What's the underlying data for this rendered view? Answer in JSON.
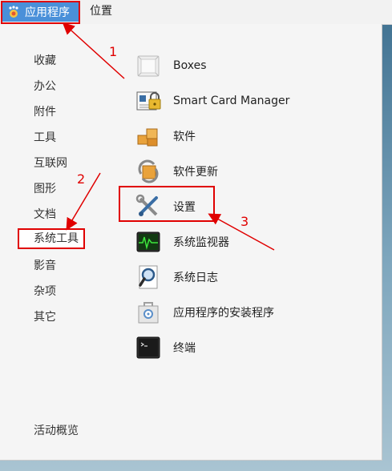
{
  "topbar": {
    "applications_label": "应用程序",
    "places_label": "位置"
  },
  "categories": [
    {
      "label": "收藏"
    },
    {
      "label": "办公"
    },
    {
      "label": "附件"
    },
    {
      "label": "工具"
    },
    {
      "label": "互联网"
    },
    {
      "label": "图形"
    },
    {
      "label": "文档"
    },
    {
      "label": "系统工具"
    },
    {
      "label": "影音"
    },
    {
      "label": "杂项"
    },
    {
      "label": "其它"
    }
  ],
  "activities_label": "活动概览",
  "apps": [
    {
      "label": "Boxes",
      "icon": "boxes-icon"
    },
    {
      "label": "Smart Card Manager",
      "icon": "smart-card-icon"
    },
    {
      "label": "软件",
      "icon": "software-icon"
    },
    {
      "label": "软件更新",
      "icon": "software-update-icon"
    },
    {
      "label": "设置",
      "icon": "settings-icon"
    },
    {
      "label": "系统监视器",
      "icon": "system-monitor-icon"
    },
    {
      "label": "系统日志",
      "icon": "system-log-icon"
    },
    {
      "label": "应用程序的安装程序",
      "icon": "app-installer-icon"
    },
    {
      "label": "终端",
      "icon": "terminal-icon"
    }
  ],
  "annotations": [
    "1",
    "2",
    "3"
  ],
  "colors": {
    "highlight": "#4a90d9",
    "annotation_red": "#e00000"
  }
}
